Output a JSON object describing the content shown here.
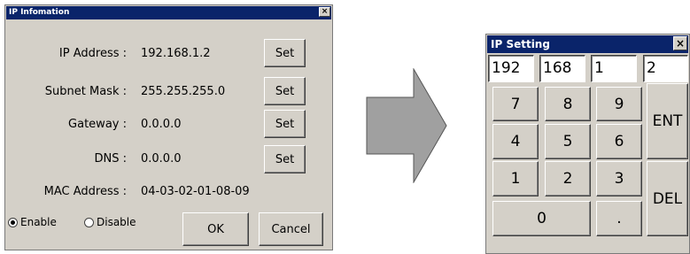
{
  "info_dialog": {
    "title": "IP Infomation",
    "close": "×",
    "rows": [
      {
        "label": "IP Address :",
        "value": "192.168.1.2",
        "button": "Set"
      },
      {
        "label": "Subnet Mask :",
        "value": "255.255.255.0",
        "button": "Set"
      },
      {
        "label": "Gateway :",
        "value": "0.0.0.0",
        "button": "Set"
      },
      {
        "label": "DNS :",
        "value": "0.0.0.0",
        "button": "Set"
      }
    ],
    "mac": {
      "label": "MAC Address :",
      "value": "04-03-02-01-08-09"
    },
    "enable": {
      "label": "Enable",
      "selected": true
    },
    "disable": {
      "label": "Disable",
      "selected": false
    },
    "ok": "OK",
    "cancel": "Cancel"
  },
  "ip_dialog": {
    "title": "IP Setting",
    "close": "×",
    "octets": [
      "192",
      "168",
      "1",
      "2"
    ],
    "keys": {
      "k7": "7",
      "k8": "8",
      "k9": "9",
      "k4": "4",
      "k5": "5",
      "k6": "6",
      "k1": "1",
      "k2": "2",
      "k3": "3",
      "k0": "0",
      "dot": ".",
      "ent": "ENT",
      "del": "DEL"
    }
  },
  "colors": {
    "dialog_bg": "#d4d0c8",
    "titlebar": "#0a246a",
    "arrow_fill": "#a0a0a0"
  },
  "icons": {
    "arrow": "right-arrow-icon"
  }
}
